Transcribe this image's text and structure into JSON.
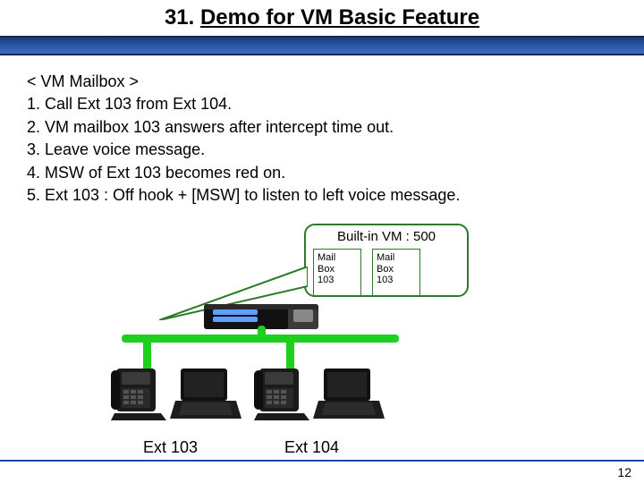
{
  "title_prefix": "31. ",
  "title_link": "Demo for VM Basic Feature",
  "steps": {
    "heading": "< VM Mailbox >",
    "s1": "1. Call Ext 103 from Ext 104.",
    "s2": "2. VM mailbox 103 answers after intercept time out.",
    "s3": "3. Leave voice message.",
    "s4": "4. MSW of Ext 103 becomes red on.",
    "s5": "5. Ext 103 : Off hook + [MSW]  to listen to left voice message."
  },
  "vm": {
    "title": "Built-in VM : 500",
    "box1_l1": "Mail",
    "box1_l2": "Box",
    "box1_l3": "103",
    "box2_l1": "Mail",
    "box2_l2": "Box",
    "box2_l3": "103"
  },
  "labels": {
    "ext103": "Ext 103",
    "ext104": "Ext 104"
  },
  "page_number": "12"
}
